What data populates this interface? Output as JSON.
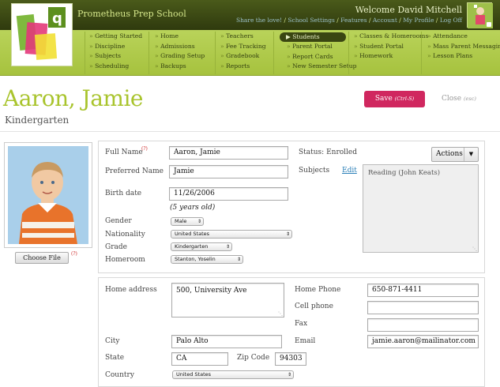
{
  "header": {
    "school_name": "Prometheus Prep School",
    "welcome": "Welcome David Mitchell",
    "links": [
      "Share the love!",
      "School Settings",
      "Features",
      "Account",
      "My Profile",
      "Log Off"
    ],
    "logo_letter": "q"
  },
  "nav": {
    "col1": [
      "Getting Started",
      "Discipline",
      "Subjects",
      "Scheduling"
    ],
    "col2": [
      "Home",
      "Admissions",
      "Grading Setup",
      "Backups"
    ],
    "col3": [
      "Teachers",
      "Fee Tracking",
      "Gradebook",
      "Reports"
    ],
    "col4_active": "Students",
    "col4": [
      "Parent Portal",
      "Report Cards",
      "New Semester Setup"
    ],
    "col5": [
      "Classes & Homerooms",
      "Student Portal",
      "Homework"
    ],
    "col6": [
      "Attendance",
      "Mass Parent Messaging",
      "Lesson Plans"
    ]
  },
  "page": {
    "title": "Aaron, Jamie",
    "subtitle": "Kindergarten",
    "save_label": "Save",
    "save_hint": "(Ctrl-S)",
    "close_label": "Close",
    "close_hint": "(esc)"
  },
  "photo": {
    "choose_file_label": "Choose File",
    "required_mark": "(?)"
  },
  "profile": {
    "full_name_label": "Full Name",
    "full_name_mark": "(?)",
    "full_name": "Aaron, Jamie",
    "preferred_name_label": "Preferred Name",
    "preferred_name": "Jamie",
    "birth_date_label": "Birth date",
    "birth_date": "11/26/2006",
    "age_note": "(5 years old)",
    "gender_label": "Gender",
    "gender": "Male",
    "nationality_label": "Nationality",
    "nationality": "United States",
    "grade_label": "Grade",
    "grade": "Kindergarten",
    "homeroom_label": "Homeroom",
    "homeroom": "Stanton, Yoselin",
    "status": "Status: Enrolled",
    "actions_label": "Actions",
    "subjects_label": "Subjects",
    "edit_label": "Edit",
    "subjects_value": "Reading (John Keats)"
  },
  "address": {
    "home_address_label": "Home address",
    "home_address": "500, University Ave",
    "city_label": "City",
    "city": "Palo Alto",
    "state_label": "State",
    "state": "CA",
    "zip_label": "Zip Code",
    "zip": "94303",
    "country_label": "Country",
    "country": "United States",
    "home_phone_label": "Home Phone",
    "home_phone": "650-871-4411",
    "cell_phone_label": "Cell phone",
    "cell_phone": "",
    "fax_label": "Fax",
    "fax": "",
    "email_label": "Email",
    "email": "jamie.aaron@mailinator.com"
  },
  "colors": {
    "accent_green": "#a9c42d",
    "save_pink": "#d0275f",
    "header_dark": "#2f3a0e",
    "nav_green": "#b9d35a"
  }
}
